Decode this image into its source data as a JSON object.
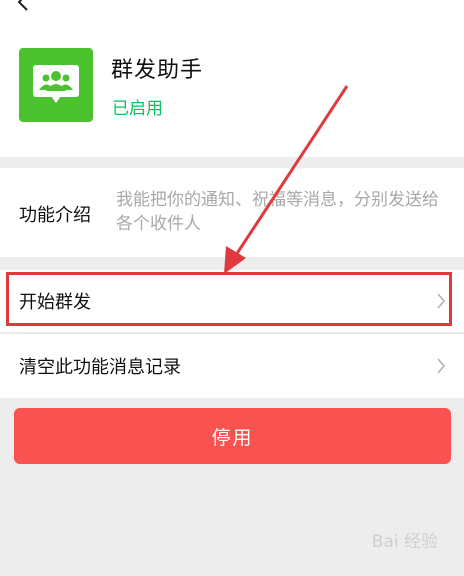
{
  "app": {
    "name": "群发助手",
    "status": "已启用",
    "icon": "group-chat-icon"
  },
  "intro": {
    "label": "功能介绍",
    "text": "我能把你的通知、祝福等消息，分别发送给各个收件人"
  },
  "menu": [
    {
      "label": "开始群发",
      "icon": "chevron-right-icon"
    },
    {
      "label": "清空此功能消息记录",
      "icon": "chevron-right-icon"
    }
  ],
  "stop_button": {
    "label": "停用"
  },
  "watermark": {
    "text": "Bai 经验"
  },
  "colors": {
    "accent_green": "#07c160",
    "icon_bg": "#4cc22e",
    "danger": "#fa5151",
    "annotation_red": "#e0393e"
  }
}
